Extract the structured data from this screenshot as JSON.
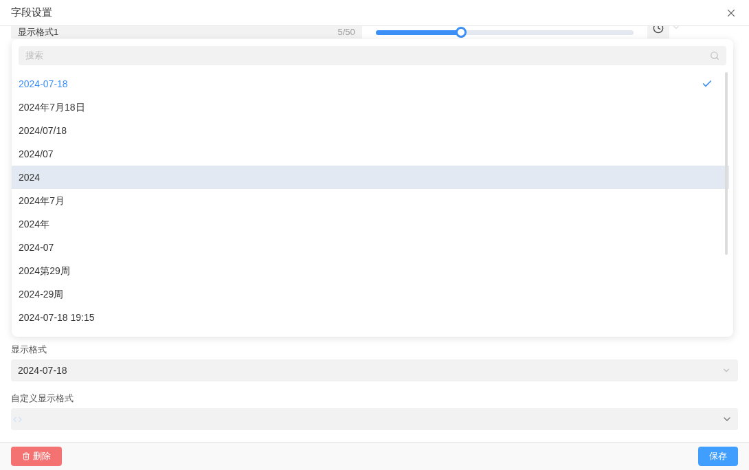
{
  "dialog": {
    "title": "字段设置"
  },
  "name_field": {
    "value": "显示格式1",
    "counter": "5/50"
  },
  "slider": {
    "level": 0.33
  },
  "dropdown": {
    "search": {
      "placeholder": "搜索"
    },
    "options": [
      {
        "label": "2024-07-18",
        "selected": true,
        "hovered": false
      },
      {
        "label": "2024年7月18日",
        "selected": false,
        "hovered": false
      },
      {
        "label": "2024/07/18",
        "selected": false,
        "hovered": false
      },
      {
        "label": "2024/07",
        "selected": false,
        "hovered": false
      },
      {
        "label": "2024",
        "selected": false,
        "hovered": true
      },
      {
        "label": "2024年7月",
        "selected": false,
        "hovered": false
      },
      {
        "label": "2024年",
        "selected": false,
        "hovered": false
      },
      {
        "label": "2024-07",
        "selected": false,
        "hovered": false
      },
      {
        "label": "2024第29周",
        "selected": false,
        "hovered": false
      },
      {
        "label": "2024-29周",
        "selected": false,
        "hovered": false
      },
      {
        "label": "2024-07-18 19:15",
        "selected": false,
        "hovered": false
      }
    ]
  },
  "fields": [
    {
      "label": "显示格式",
      "kind": "select",
      "value": "2024-07-18"
    },
    {
      "label": "自定义显示格式",
      "kind": "code"
    }
  ],
  "footer": {
    "delete": "删除",
    "save": "保存"
  }
}
